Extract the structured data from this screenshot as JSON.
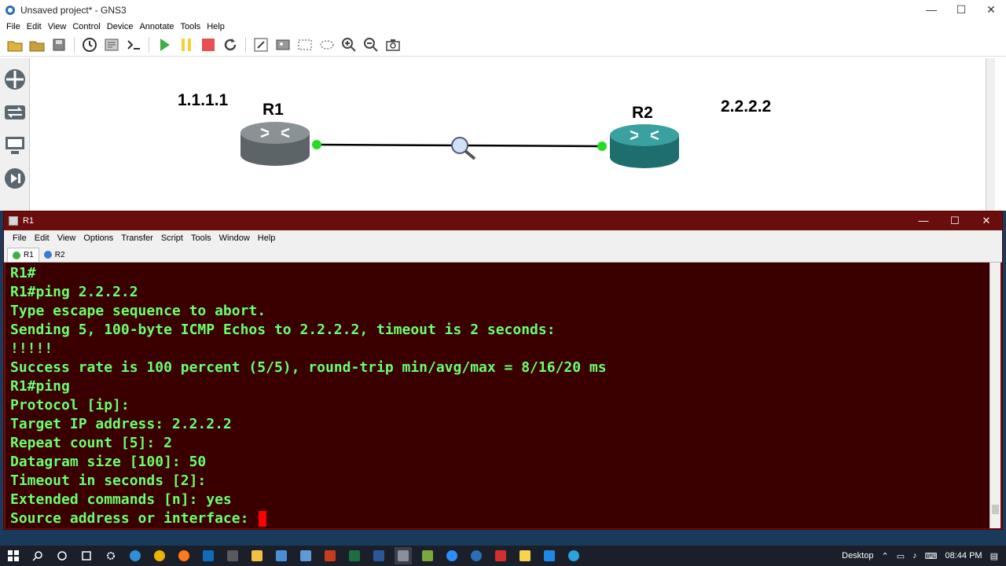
{
  "gns3": {
    "window_title": "Unsaved project* - GNS3",
    "menu": [
      "File",
      "Edit",
      "View",
      "Control",
      "Device",
      "Annotate",
      "Tools",
      "Help"
    ],
    "window_controls": {
      "minimize": "—",
      "maximize": "☐",
      "close": "✕"
    }
  },
  "topology": {
    "r1": {
      "label": "R1",
      "ip": "1.1.1.1",
      "color": "#6d7478"
    },
    "r2": {
      "label": "R2",
      "ip": "2.2.2.2",
      "color": "#2e8a8a"
    },
    "link_endpoint_color": "#22dd22"
  },
  "terminal": {
    "window_title": "R1",
    "menu": [
      "File",
      "Edit",
      "View",
      "Options",
      "Transfer",
      "Script",
      "Tools",
      "Window",
      "Help"
    ],
    "tabs": [
      {
        "label": "R1",
        "active": true
      },
      {
        "label": "R2",
        "active": false
      }
    ],
    "lines": [
      "R1#",
      "R1#ping 2.2.2.2",
      "Type escape sequence to abort.",
      "Sending 5, 100-byte ICMP Echos to 2.2.2.2, timeout is 2 seconds:",
      "!!!!!",
      "Success rate is 100 percent (5/5), round-trip min/avg/max = 8/16/20 ms",
      "R1#ping",
      "Protocol [ip]:",
      "Target IP address: 2.2.2.2",
      "Repeat count [5]: 2",
      "Datagram size [100]: 50",
      "Timeout in seconds [2]:",
      "Extended commands [n]: yes",
      "Source address or interface: "
    ],
    "text_color": "#6bff6b",
    "cursor_color": "#ff0000"
  },
  "taskbar": {
    "desktop_label": "Desktop",
    "time": "08:44 PM"
  }
}
